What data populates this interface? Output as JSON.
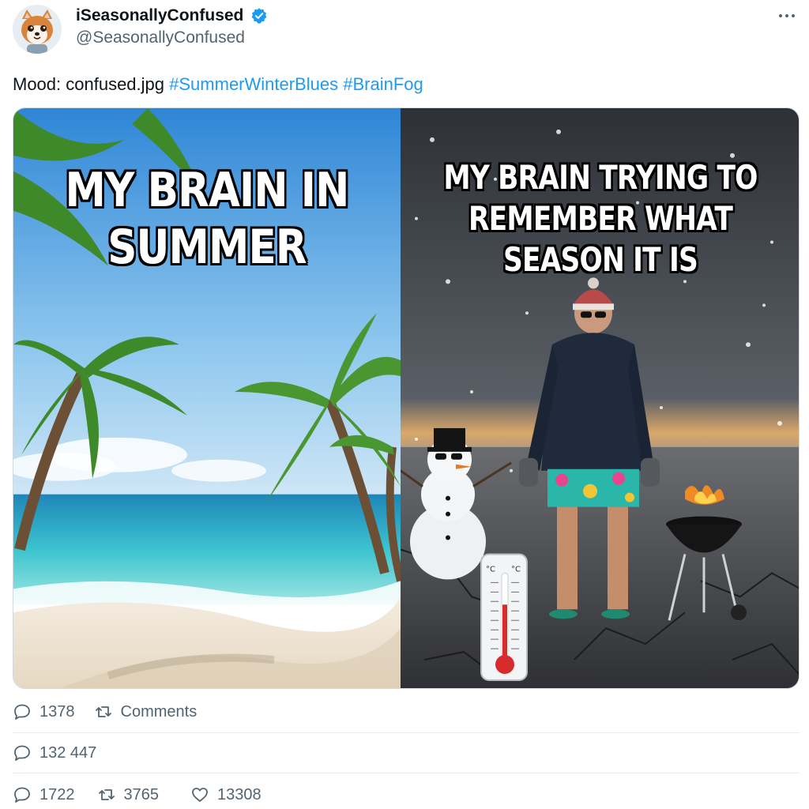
{
  "user": {
    "display_name": "iSeasonallyConfused",
    "handle": "@SeasonallyConfused",
    "verified": true,
    "avatar_icon": "shiba-dog-avatar"
  },
  "tweet": {
    "text_prefix": "Mood: confused.jpg ",
    "hashtags": [
      "#SummerWinterBlues",
      "#BrainFog"
    ]
  },
  "media": {
    "left_caption": "MY BRAIN IN SUMMER",
    "right_caption": "MY BRAIN TRYING TO REMEMBER WHAT SEASON IT IS",
    "thermometer_labels": [
      "°C",
      "°C"
    ]
  },
  "stats_row1": {
    "replies": "1378",
    "retweet_label": "Comments"
  },
  "stats_row2": {
    "replies": "132 447"
  },
  "stats_row3": {
    "replies": "1722",
    "retweets": "3765",
    "likes": "13308"
  },
  "colors": {
    "accent": "#1d9bf0",
    "muted": "#536471"
  }
}
